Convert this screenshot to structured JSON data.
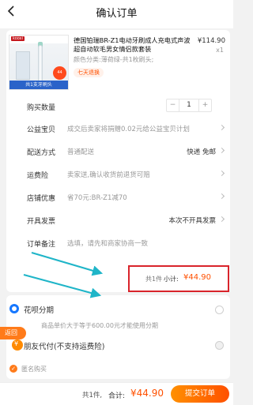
{
  "header": {
    "title": "确认订单"
  },
  "product": {
    "thumb_brand": "kooxi",
    "thumb_badge": "44",
    "thumb_banner": "共1支牙刷头",
    "title": "德国铂瑞BR-Z1电动牙刷成人充电式声波超自动软毛男女情侣款套装",
    "price": "¥114.90",
    "qty": "x1",
    "variant": "颜色分类:薄荷绿-共1枚刷头;",
    "tag": "七天退换"
  },
  "rows": {
    "quantity_label": "购买数量",
    "quantity_value": "1",
    "minus": "−",
    "plus": "+",
    "charity_label": "公益宝贝",
    "charity_text": "成交后卖家将捐赠0.02元给公益宝贝计划",
    "delivery_label": "配送方式",
    "delivery_text": "普通配送",
    "delivery_value": "快递 免邮",
    "insurance_label": "运费险",
    "insurance_text": "卖家送,确认收货前退货可赔",
    "discount_label": "店铺优惠",
    "discount_text": "省70元:BR-Z1减70",
    "invoice_label": "开具发票",
    "invoice_value": "本次不开具发票",
    "note_label": "订单备注",
    "note_placeholder": "选填，请先和商家协商一致"
  },
  "subtotal": {
    "count": "共1件",
    "label": "小计:",
    "amount": "¥44.90"
  },
  "payment": {
    "huabei_label": "花呗分期",
    "huabei_note": "商品单价大于等于600.00元才能使用分期",
    "friend_label": "朋友代付(不支持运费险)"
  },
  "float_back": "返回",
  "anonymous": {
    "icon": "✓",
    "label": "匿名购买"
  },
  "bottom": {
    "count": "共1件,",
    "total_label": "合计:",
    "total_amount": "¥44.90",
    "submit": "提交订单"
  },
  "colors": {
    "accent": "#ff5000",
    "highlight_box": "#d9242b",
    "arrow": "#1fb5c8"
  },
  "icons": [
    "back-arrow-icon",
    "chevron-right-icon",
    "huabei-icon",
    "friend-pay-icon",
    "anonymous-check-icon"
  ]
}
